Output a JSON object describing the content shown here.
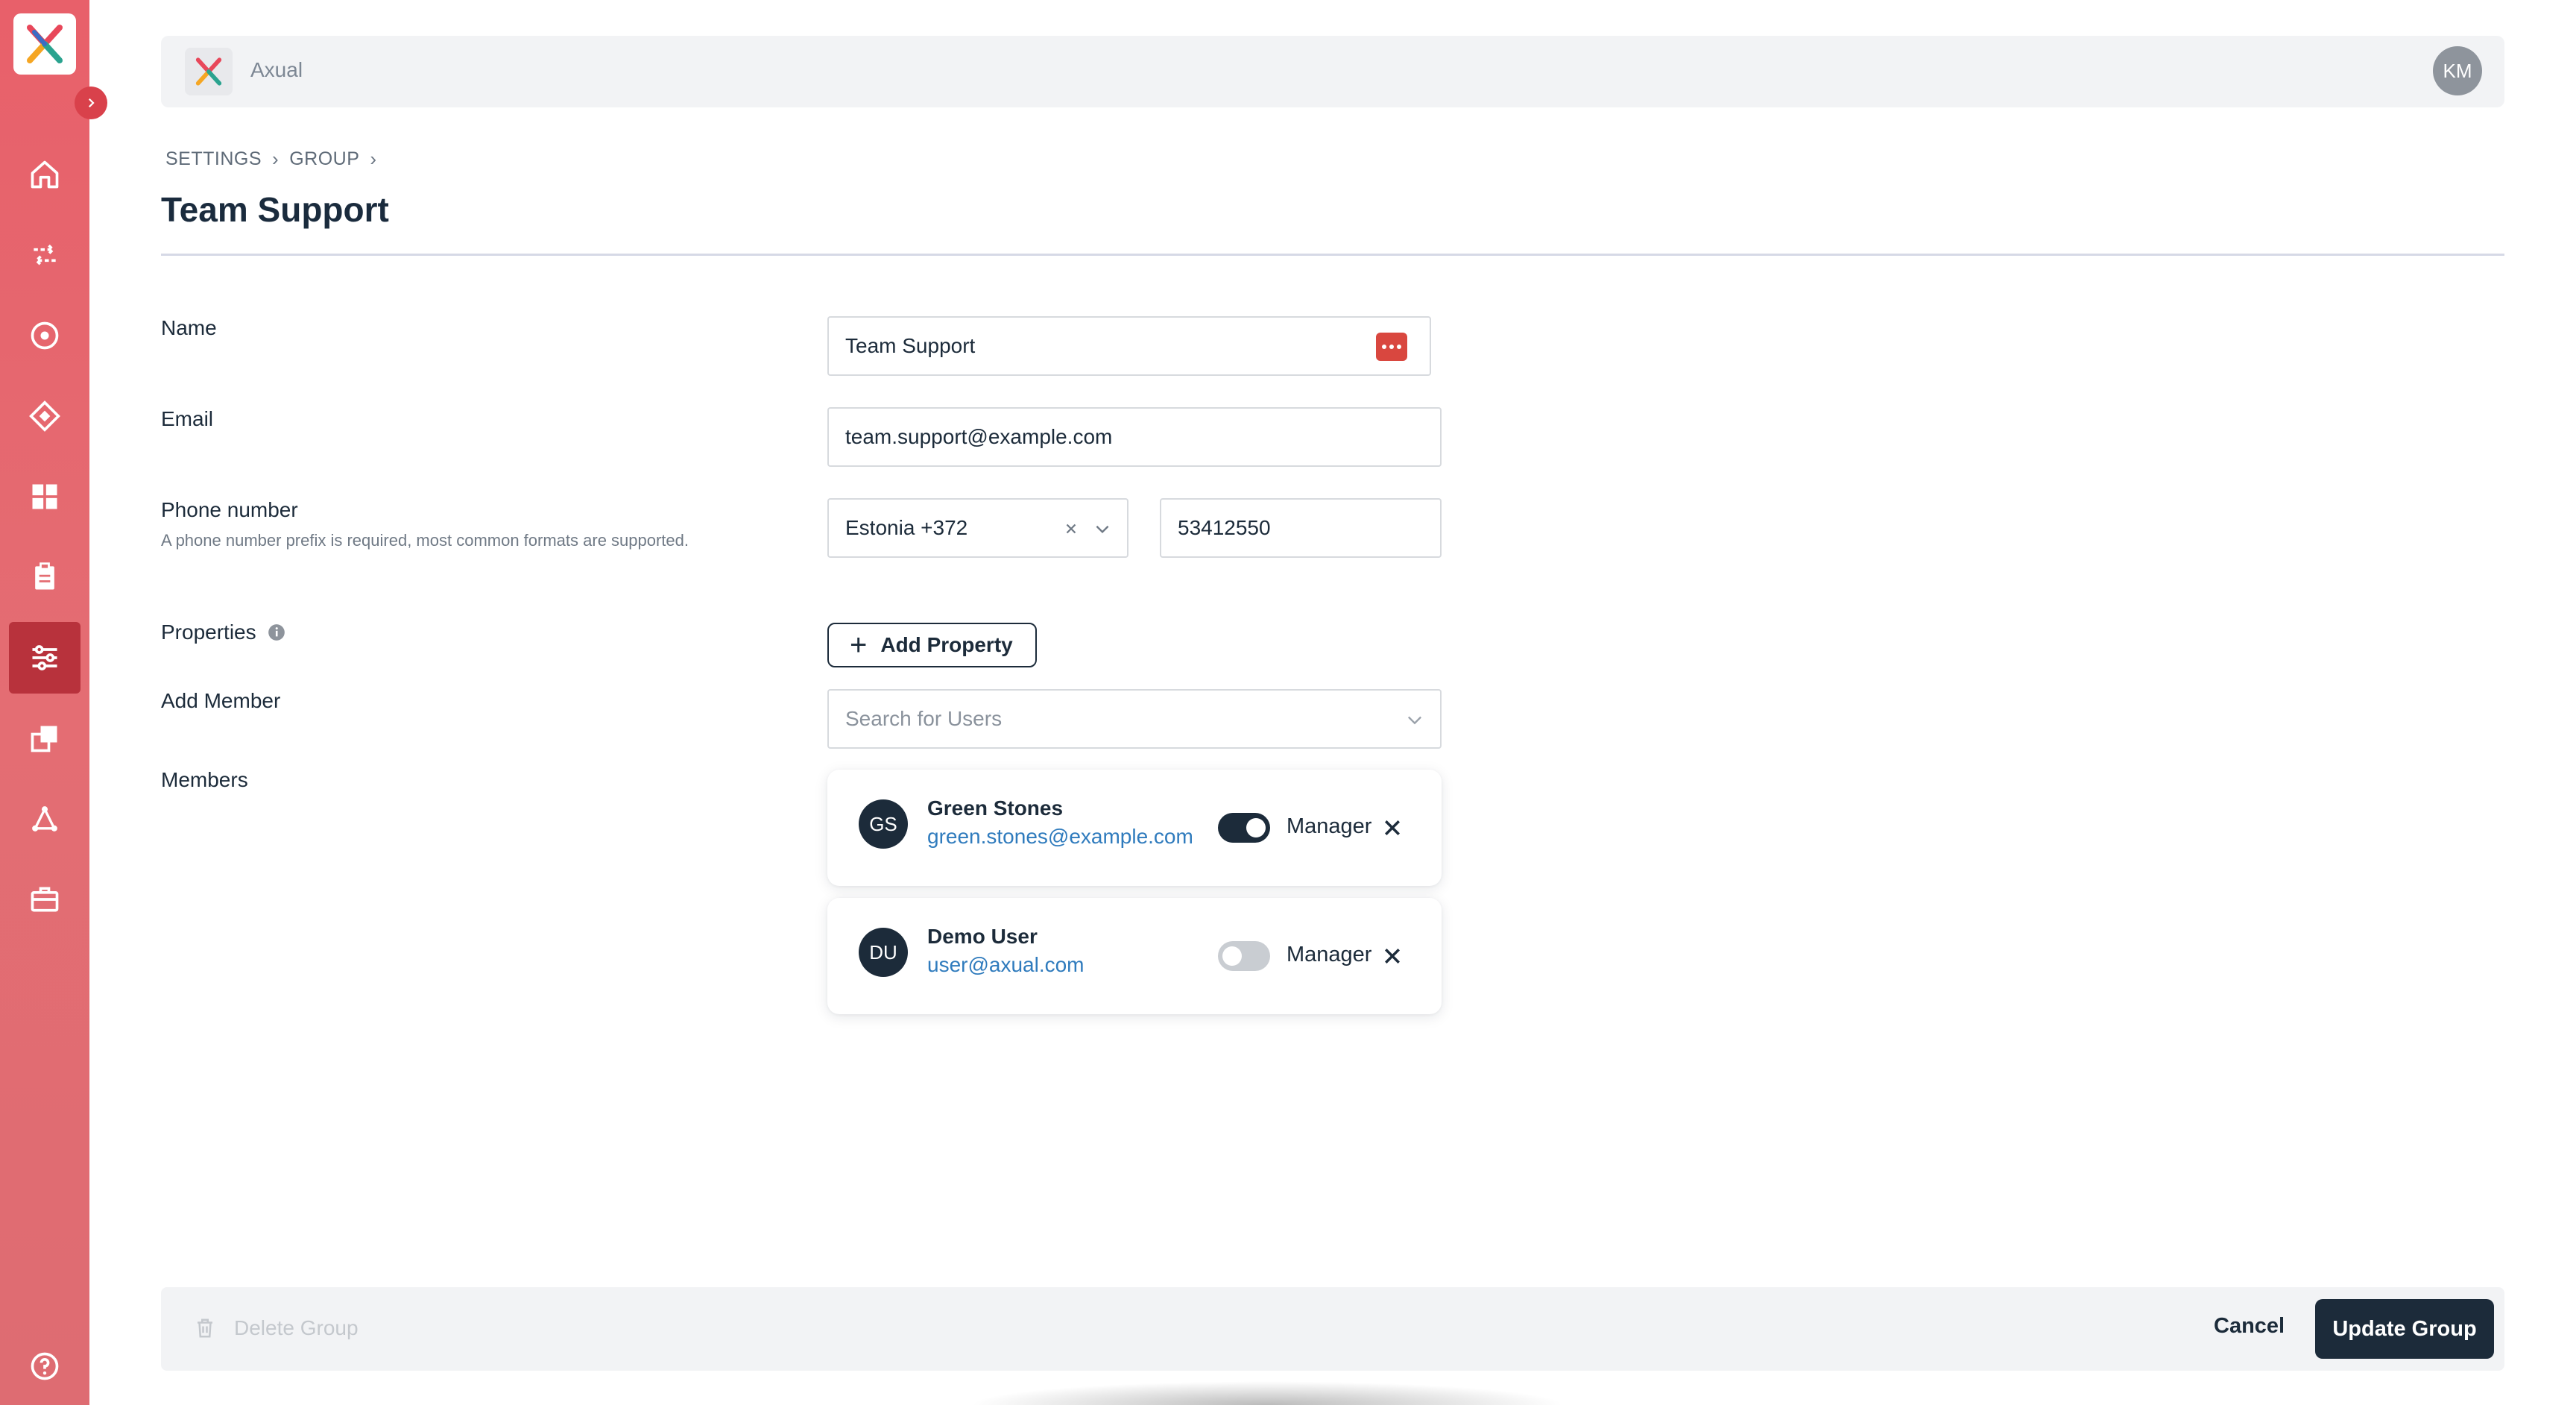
{
  "app": {
    "name": "Axual",
    "user_initials": "KM"
  },
  "breadcrumb": [
    "SETTINGS",
    "GROUP"
  ],
  "page": {
    "title": "Team Support"
  },
  "form": {
    "name_label": "Name",
    "name_value": "Team Support",
    "email_label": "Email",
    "email_value": "team.support@example.com",
    "phone_label": "Phone number",
    "phone_hint": "A phone number prefix is required, most common formats are supported.",
    "phone_country": "Estonia +372",
    "phone_number": "53412550",
    "properties_label": "Properties",
    "add_property_label": "Add Property",
    "add_member_label": "Add Member",
    "search_placeholder": "Search for Users",
    "members_label": "Members"
  },
  "members": [
    {
      "initials": "GS",
      "name": "Green Stones",
      "email": "green.stones@example.com",
      "manager": true,
      "manager_label": "Manager"
    },
    {
      "initials": "DU",
      "name": "Demo User",
      "email": "user@axual.com",
      "manager": false,
      "manager_label": "Manager"
    }
  ],
  "footer": {
    "delete_label": "Delete Group",
    "cancel_label": "Cancel",
    "update_label": "Update Group"
  },
  "sidebar": {
    "items": [
      {
        "icon": "home-icon"
      },
      {
        "icon": "streams-icon"
      },
      {
        "icon": "target-icon"
      },
      {
        "icon": "diamond-icon"
      },
      {
        "icon": "dashboard-icon"
      },
      {
        "icon": "clipboard-icon"
      },
      {
        "icon": "settings-sliders-icon",
        "active": true
      },
      {
        "icon": "copy-icon"
      },
      {
        "icon": "graph-icon"
      },
      {
        "icon": "briefcase-icon"
      },
      {
        "icon": "help-icon"
      }
    ]
  },
  "colors": {
    "sidebar": "#e8606a",
    "primary": "#1c2b3a",
    "link": "#2f7bbd",
    "accent_red": "#d9473f"
  }
}
